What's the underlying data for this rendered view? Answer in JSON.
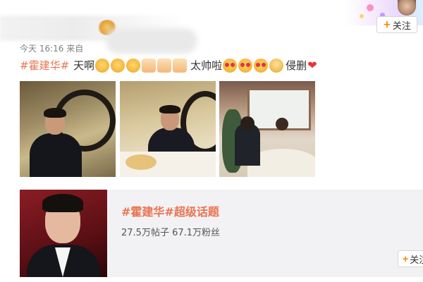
{
  "header": {
    "follow_label": "关注",
    "follow_icon": "plus-icon"
  },
  "post": {
    "meta": "今天 16:16 来自",
    "text_before_emojis": "天啊",
    "hashtag": "#霍建华#",
    "text_middle": "太帅啦",
    "text_end": "侵删",
    "emojis_1": [
      "scared-face",
      "scared-face",
      "scared-face",
      "thumbs-up",
      "thumbs-up",
      "thumbs-up"
    ],
    "emojis_2": [
      "heart-eyes-face",
      "heart-eyes-face",
      "heart-eyes-face",
      "bow-face"
    ],
    "end_emoji": "red-heart"
  },
  "photos": [
    {
      "name": "photo-1"
    },
    {
      "name": "photo-2"
    },
    {
      "name": "photo-3"
    }
  ],
  "topic_card": {
    "title": "#霍建华#超级话题",
    "stats": "27.5万帖子  67.1万粉丝",
    "follow_label": "关注",
    "follow_icon": "plus-icon"
  },
  "colors": {
    "hashtag": "#eb7350",
    "follow_plus": "#ff8200",
    "card_bg": "#f2f2f5"
  }
}
